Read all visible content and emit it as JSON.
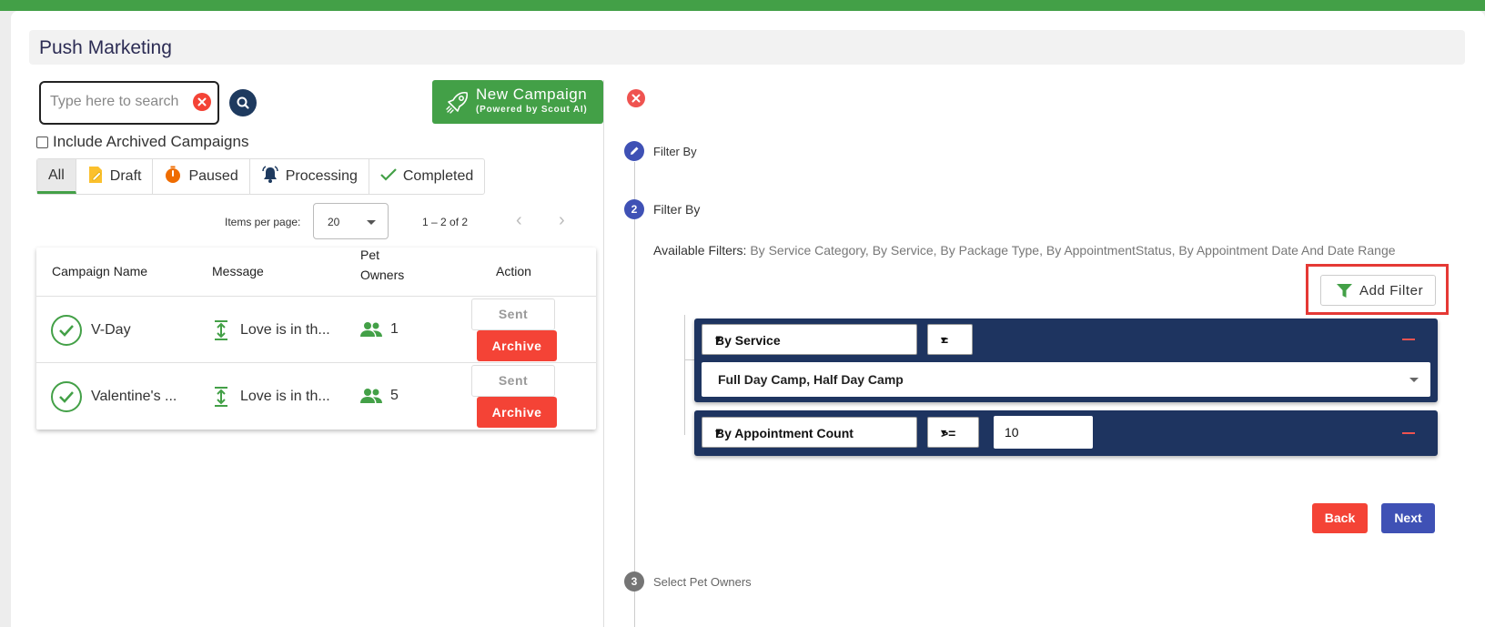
{
  "page": {
    "title": "Push Marketing"
  },
  "colors": {
    "green": "#43a047",
    "red": "#f44336",
    "navy": "#1e3460",
    "indigo": "#3f51b5"
  },
  "search": {
    "placeholder": "Type here to search",
    "clear_icon": "close-circle-icon",
    "search_icon": "search-icon"
  },
  "new_campaign": {
    "label": "New Campaign",
    "sublabel": "(Powered by Scout AI)",
    "icon": "rocket-icon"
  },
  "archived": {
    "label": "Include Archived Campaigns",
    "checked": false
  },
  "tabs": [
    {
      "label": "All",
      "icon": "",
      "active": true
    },
    {
      "label": "Draft",
      "icon": "draft-icon"
    },
    {
      "label": "Paused",
      "icon": "timer-icon"
    },
    {
      "label": "Processing",
      "icon": "bell-icon"
    },
    {
      "label": "Completed",
      "icon": "check-icon"
    }
  ],
  "pager": {
    "items_per_page_label": "Items per page:",
    "items_per_page": "20",
    "range": "1 – 2 of 2"
  },
  "table": {
    "headers": {
      "name": "Campaign Name",
      "message": "Message",
      "pet_owners_1": "Pet",
      "pet_owners_2": "Owners",
      "action": "Action"
    },
    "rows": [
      {
        "name": "V-Day",
        "message": "Love is in th...",
        "pet_owners": "1",
        "sent_label": "Sent",
        "archive_label": "Archive"
      },
      {
        "name": "Valentine's ...",
        "message": "Love is in th...",
        "pet_owners": "5",
        "sent_label": "Sent",
        "archive_label": "Archive"
      }
    ]
  },
  "stepper": {
    "step1": {
      "label": "Filter By",
      "icon": "pencil-icon"
    },
    "step2": {
      "number": "2",
      "label": "Filter By"
    },
    "step3": {
      "number": "3",
      "label": "Select Pet Owners"
    }
  },
  "filters": {
    "available_label": "Available Filters:",
    "available_value": "By Service Category, By Service, By Package Type, By AppointmentStatus, By Appointment Date And Date Range",
    "add_filter_label": "Add Filter",
    "filter1": {
      "field": "By Service",
      "operator": "=",
      "value": "Full Day Camp, Half Day Camp"
    },
    "filter2": {
      "field": "By Appointment Count",
      "operator": ">=",
      "value": "10"
    }
  },
  "actions": {
    "back_label": "Back",
    "next_label": "Next"
  }
}
